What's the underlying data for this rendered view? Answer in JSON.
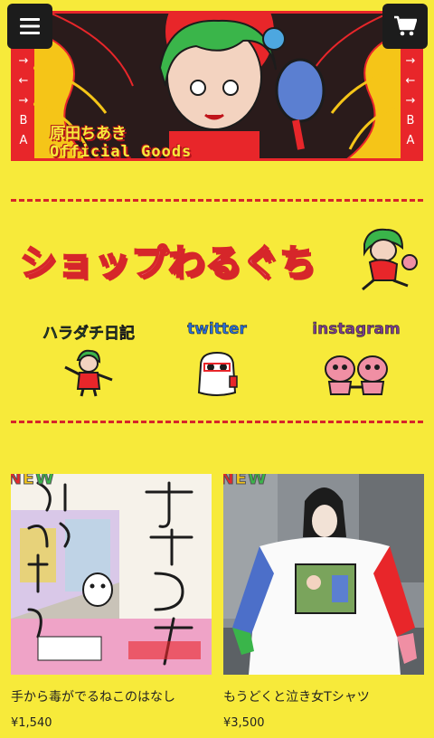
{
  "banner": {
    "title_line1": "原田ちあき",
    "title_line2": "Official Goods",
    "side_glyphs": [
      "→",
      "←",
      "→",
      "B",
      "A"
    ]
  },
  "header": {
    "menu_icon": "hamburger-menu-icon",
    "cart_icon": "shopping-cart-icon"
  },
  "shop": {
    "title": "ショップわるぐち"
  },
  "social": [
    {
      "label": "ハラダチ日記",
      "color": "#2fa84f"
    },
    {
      "label": "twitter",
      "color": "#2a6fd6"
    },
    {
      "label": "instagram",
      "color": "#7a3c8c"
    }
  ],
  "products": [
    {
      "badge": "NEW",
      "name": "手から毒がでるねこのはなし",
      "price": "¥1,540"
    },
    {
      "badge": "NEW",
      "name": "もうどくと泣き女Tシャツ",
      "price": "¥3,500"
    }
  ],
  "colors": {
    "background": "#f7ea3a",
    "accent": "#d6262a",
    "dark": "#1c1c1c"
  }
}
